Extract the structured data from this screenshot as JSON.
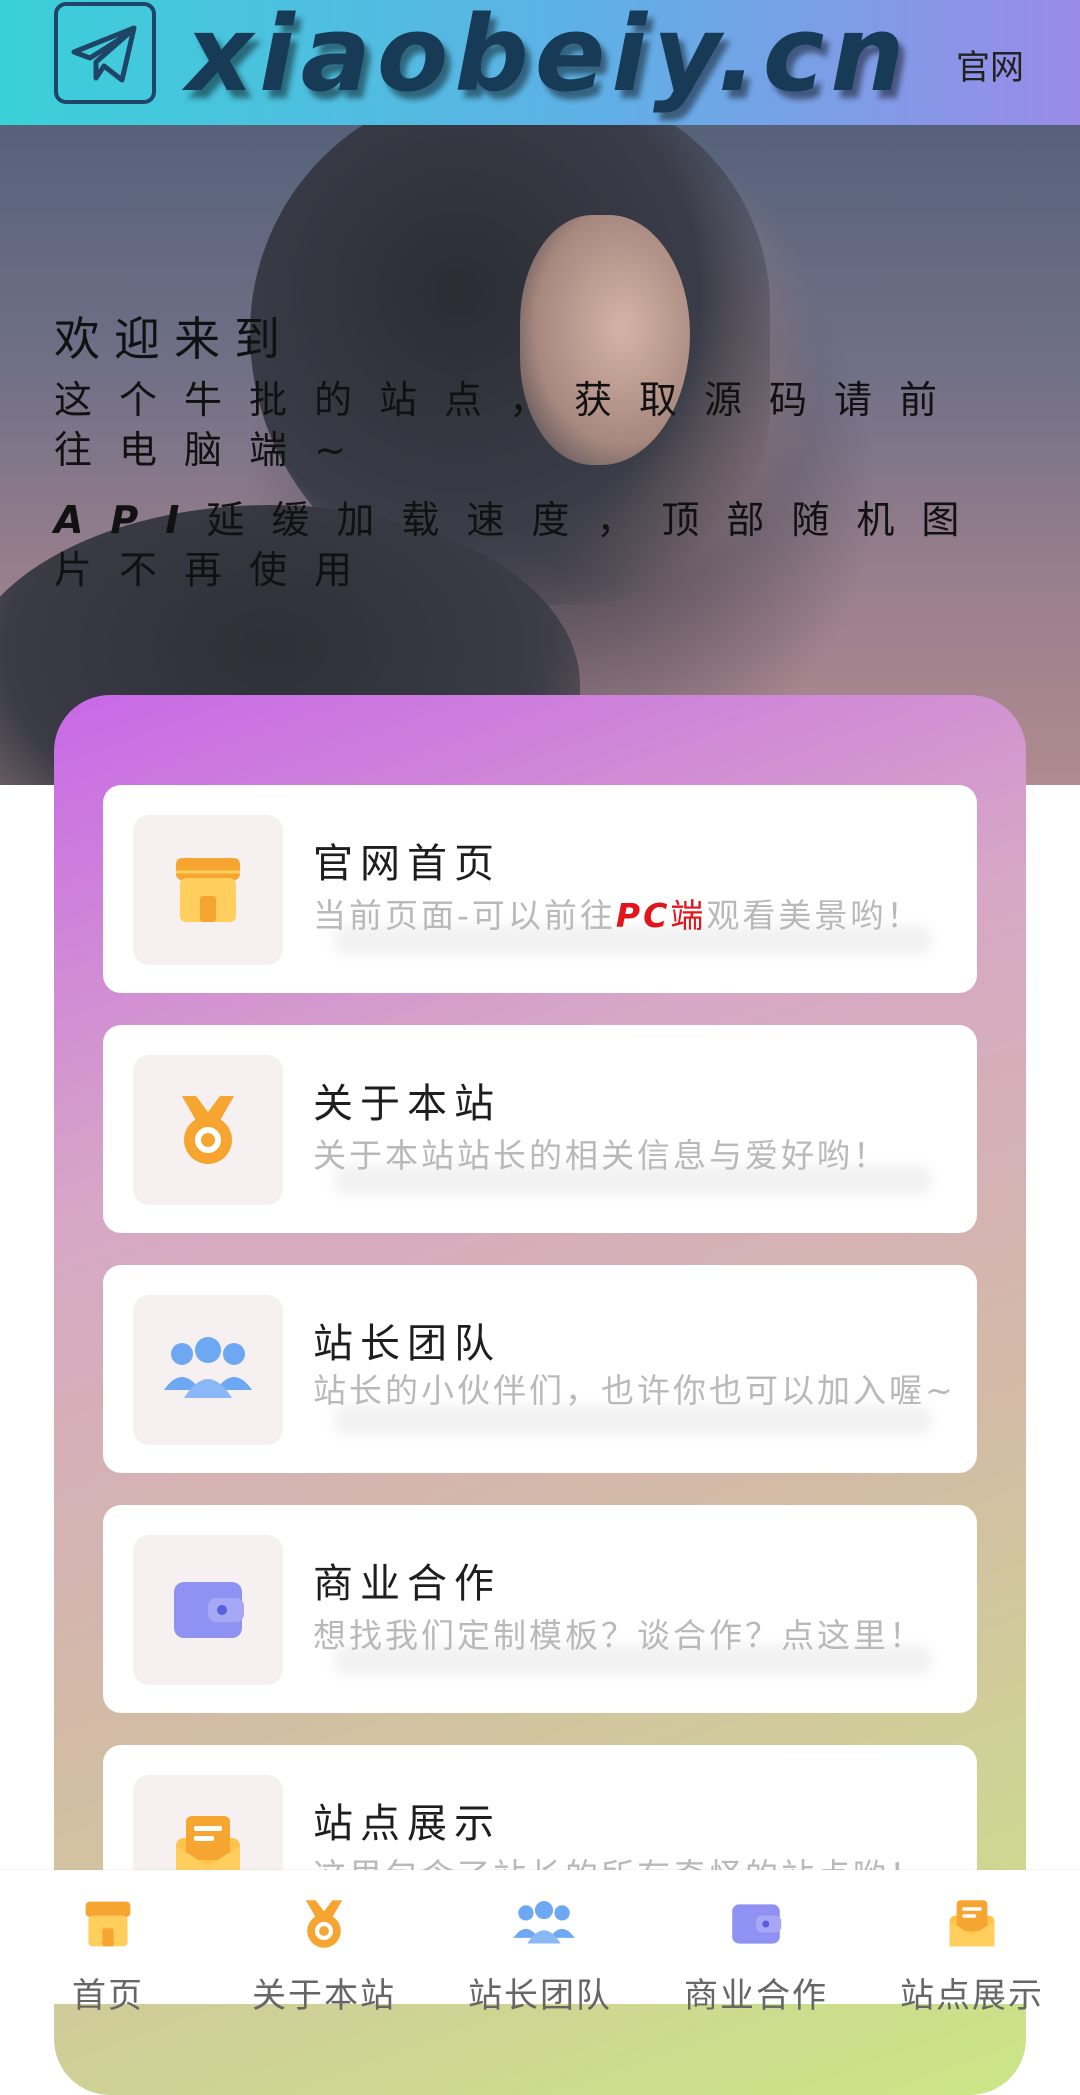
{
  "header": {
    "logo_text": "xiaobeiy.cn",
    "nav_link": "官网"
  },
  "hero": {
    "welcome": "欢迎来到",
    "line1": "这个牛批的站点，获取源码请前往电脑端~",
    "line2_api": "API",
    "line2_rest": "延缓加载速度，顶部随机图片不再使用"
  },
  "cards": [
    {
      "title": "官网首页",
      "desc_prefix": "当前页面-可以前往",
      "desc_pc": "PC",
      "desc_pc2": "端",
      "desc_suffix": "观看美景哟！",
      "icon": "shop-icon"
    },
    {
      "title": "关于本站",
      "desc": "关于本站站长的相关信息与爱好哟！",
      "icon": "medal-icon"
    },
    {
      "title": "站长团队",
      "desc": "站长的小伙伴们，也许你也可以加入喔~",
      "icon": "team-icon"
    },
    {
      "title": "商业合作",
      "desc": "想找我们定制模板？谈合作？点这里！",
      "icon": "wallet-icon"
    },
    {
      "title": "站点展示",
      "desc": "这里包含了站长的所有奇怪的站点哟！",
      "icon": "mail-icon"
    }
  ],
  "tabs": [
    {
      "label": "首页",
      "icon": "shop-icon"
    },
    {
      "label": "关于本站",
      "icon": "medal-icon"
    },
    {
      "label": "站长团队",
      "icon": "team-icon"
    },
    {
      "label": "商业合作",
      "icon": "wallet-icon"
    },
    {
      "label": "站点展示",
      "icon": "mail-icon"
    }
  ],
  "colors": {
    "accent_red": "#e3141b",
    "icon_orange": "#f7a531",
    "icon_blue": "#6ea7f2",
    "icon_purple": "#8f92f2"
  }
}
